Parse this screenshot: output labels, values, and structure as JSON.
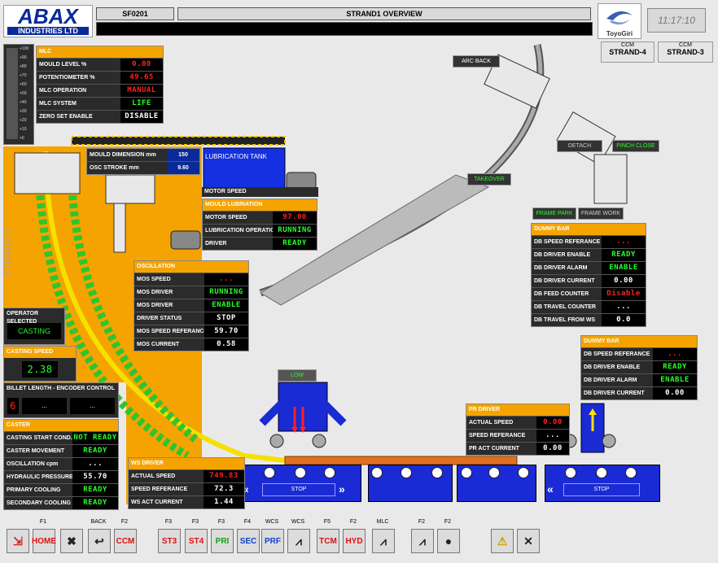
{
  "header": {
    "logo_main": "ABAX",
    "logo_sub": "INDUSTRIES LTD",
    "station": "SF0201",
    "title": "STRAND1 OVERVIEW",
    "time": "11:17:10",
    "brand": "ToyoGiri"
  },
  "strand_tabs": [
    {
      "top": "CCM",
      "label": "STRAND-4"
    },
    {
      "top": "CCM",
      "label": "STRAND-3"
    }
  ],
  "gauge_ticks": [
    "+100",
    "+90",
    "+80",
    "+70",
    "+60",
    "+50",
    "+40",
    "+30",
    "+20",
    "+10",
    "+0"
  ],
  "strand_vertical_label": "STRAND 1",
  "mlc": {
    "title": "MLC",
    "rows": [
      {
        "label": "MOULD LEVEL %",
        "value": "0.00",
        "color": "red"
      },
      {
        "label": "POTENTIOMETER %",
        "value": "49.65",
        "color": "red"
      },
      {
        "label": "MLC OPERATION",
        "value": "MANUAL",
        "color": "red"
      },
      {
        "label": "MLC SYSTEM",
        "value": "LIFE",
        "color": "green"
      },
      {
        "label": "ZERO SET ENABLE",
        "value": "DISABLE",
        "color": "white"
      }
    ]
  },
  "mould": {
    "rows": [
      {
        "label": "MOULD DIMENSION mm",
        "value": "150"
      },
      {
        "label": "OSC STROKE mm",
        "value": "9.60"
      }
    ]
  },
  "lubrication_tank": {
    "title": "LUBRICATION TANK",
    "motor_speed_label": "MOTOR SPEED"
  },
  "mould_lubriation": {
    "title": "MOULD LUBRIATION",
    "rows": [
      {
        "label": "MOTOR SPEED",
        "value": "97.00",
        "color": "red"
      },
      {
        "label": "LUBRICATION OPERATION",
        "value": "RUNNING",
        "color": "green"
      },
      {
        "label": "DRIVER",
        "value": "READY",
        "color": "green"
      }
    ]
  },
  "oscillation": {
    "title": "OSCILLATION",
    "rows": [
      {
        "label": "MOS SPEED",
        "value": "...",
        "color": "red"
      },
      {
        "label": "MOS DRIVER",
        "value": "RUNNING",
        "color": "green"
      },
      {
        "label": "MOS DRIVER",
        "value": "ENABLE",
        "color": "green"
      },
      {
        "label": "DRIVER STATUS",
        "value": "STOP",
        "color": "white"
      },
      {
        "label": "MOS SPEED REFERANCE",
        "value": "59.70",
        "color": "white"
      },
      {
        "label": "MOS CURRENT",
        "value": "0.58",
        "color": "white"
      }
    ]
  },
  "operator": {
    "title": "OPERATOR SELECTED",
    "value": "CASTING"
  },
  "casting_speed": {
    "title": "CASTING SPEED",
    "value": "2.38"
  },
  "billet": {
    "title": "BILLET LENGTH - ENCODER CONTROL",
    "v1": "6",
    "v2": "...",
    "v3": "..."
  },
  "caster": {
    "title": "CASTER",
    "rows": [
      {
        "label": "CASTING START COND.",
        "value": "NOT READY",
        "color": "green"
      },
      {
        "label": "CASTER MOVEMENT",
        "value": "READY",
        "color": "green"
      },
      {
        "label": "OSCILLATION cpm",
        "value": "...",
        "color": "white"
      },
      {
        "label": "HYDRAULIC PRESSURE",
        "value": "55.70",
        "color": "white"
      },
      {
        "label": "PRIMARY COOLING",
        "value": "READY",
        "color": "green"
      },
      {
        "label": "SECONDARY COOLING",
        "value": "READY",
        "color": "green"
      }
    ]
  },
  "ws_driver": {
    "title": "WS DRIVER",
    "rows": [
      {
        "label": "ACTUAL SPEED",
        "value": "749.83",
        "color": "red"
      },
      {
        "label": "SPEED REFERANCE",
        "value": "72.3",
        "color": "white"
      },
      {
        "label": "WS ACT CURRENT",
        "value": "1.44",
        "color": "white"
      }
    ]
  },
  "pr_driver": {
    "title": "PR DRIVER",
    "rows": [
      {
        "label": "ACTUAL SPEED",
        "value": "0.00",
        "color": "red"
      },
      {
        "label": "SPEED REFERANCE",
        "value": "...",
        "color": "white"
      },
      {
        "label": "PR ACT CURRENT",
        "value": "0.00",
        "color": "white"
      }
    ]
  },
  "dummy_bar_1": {
    "title": "DUMMY BAR",
    "rows": [
      {
        "label": "DB SPEED REFERANCE",
        "value": "...",
        "color": "red"
      },
      {
        "label": "DB DRIVER ENABLE",
        "value": "READY",
        "color": "green"
      },
      {
        "label": "DB DRIVER ALARM",
        "value": "ENABLE",
        "color": "green"
      },
      {
        "label": "DB DRIVER CURRENT",
        "value": "0.00",
        "color": "white"
      },
      {
        "label": "DB FEED COUNTER",
        "value": "Disable",
        "color": "red"
      },
      {
        "label": "DB TRAVEL COUNTER",
        "value": "...",
        "color": "white"
      },
      {
        "label": "DB TRAVEL FROM WS",
        "value": "0.0",
        "color": "white"
      }
    ]
  },
  "dummy_bar_2": {
    "title": "DUMMY BAR",
    "rows": [
      {
        "label": "DB SPEED REFERANCE",
        "value": "...",
        "color": "red"
      },
      {
        "label": "DB DRIVER ENABLE",
        "value": "READY",
        "color": "green"
      },
      {
        "label": "DB DRIVER ALARM",
        "value": "ENABLE",
        "color": "green"
      },
      {
        "label": "DB DRIVER CURRENT",
        "value": "0.00",
        "color": "white"
      }
    ]
  },
  "buttons": {
    "arc_back": "ARC BACK",
    "detach": "DETACH",
    "pinch_close": "PINCH CLOSE",
    "takeover": "TAKEOVER",
    "frame_park": "FRAME PARK",
    "frame_work": "FRAME WORK",
    "low": "LOW",
    "stop1": "STOP",
    "stop2": "STOP"
  },
  "fkeys": [
    {
      "top": "",
      "label": "",
      "icon": "exit-icon"
    },
    {
      "top": "F1",
      "label": "HOME",
      "icon": ""
    },
    {
      "top": "",
      "label": "",
      "icon": "alarm-icon"
    },
    {
      "top": "BACK",
      "label": "",
      "icon": "back-icon"
    },
    {
      "top": "F2",
      "label": "CCM",
      "icon": ""
    },
    {
      "top": "F3",
      "label": "ST3",
      "icon": ""
    },
    {
      "top": "F3",
      "label": "ST4",
      "icon": ""
    },
    {
      "top": "F3",
      "label": "PRI",
      "icon": ""
    },
    {
      "top": "F4",
      "label": "SEC",
      "icon": ""
    },
    {
      "top": "WCS",
      "label": "PRF",
      "icon": ""
    },
    {
      "top": "WCS",
      "label": "",
      "icon": "trend-icon"
    },
    {
      "top": "F5",
      "label": "TCM",
      "icon": ""
    },
    {
      "top": "F2",
      "label": "HYD",
      "icon": ""
    },
    {
      "top": "MLC",
      "label": "",
      "icon": "trend-icon"
    },
    {
      "top": "F2",
      "label": "",
      "icon": "trend-icon"
    },
    {
      "top": "F2",
      "label": "",
      "icon": "alarm-bell-icon"
    },
    {
      "top": "",
      "label": "",
      "icon": "warning-icon"
    },
    {
      "top": "",
      "label": "",
      "icon": "mute-icon"
    }
  ],
  "colors": {
    "orange": "#f5a300",
    "blue": "#1a2ad4",
    "green": "#28ff28",
    "red": "#ff2020"
  }
}
